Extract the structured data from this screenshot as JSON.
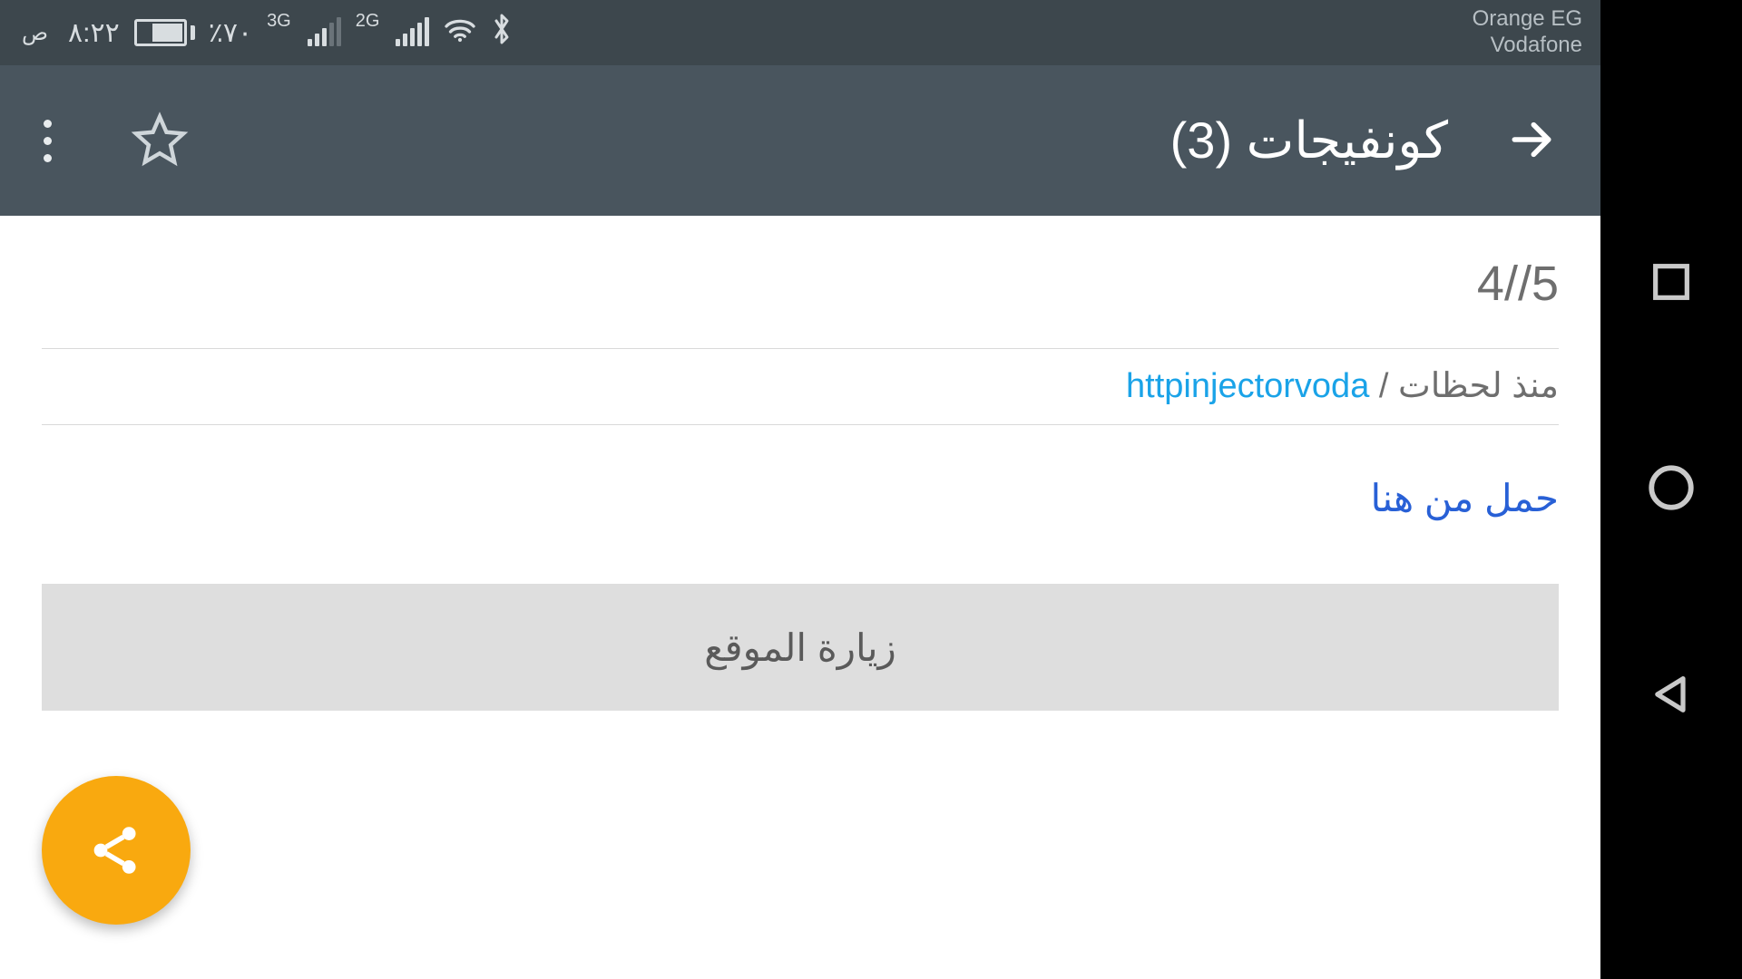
{
  "status_bar": {
    "time": "٨:٢٢",
    "ampm": "ص",
    "battery_pct": "٪٧٠",
    "net1": "3G",
    "net2": "2G",
    "carrier1": "Orange EG",
    "carrier2": "Vodafone"
  },
  "app_bar": {
    "title": "كونفيجات (3)"
  },
  "post": {
    "title": "5//4",
    "time_ago": "منذ لحظات",
    "separator": " / ",
    "channel": "httpinjectorvoda",
    "download_text": "حمل من هنا",
    "visit_site_label": "زيارة الموقع"
  }
}
